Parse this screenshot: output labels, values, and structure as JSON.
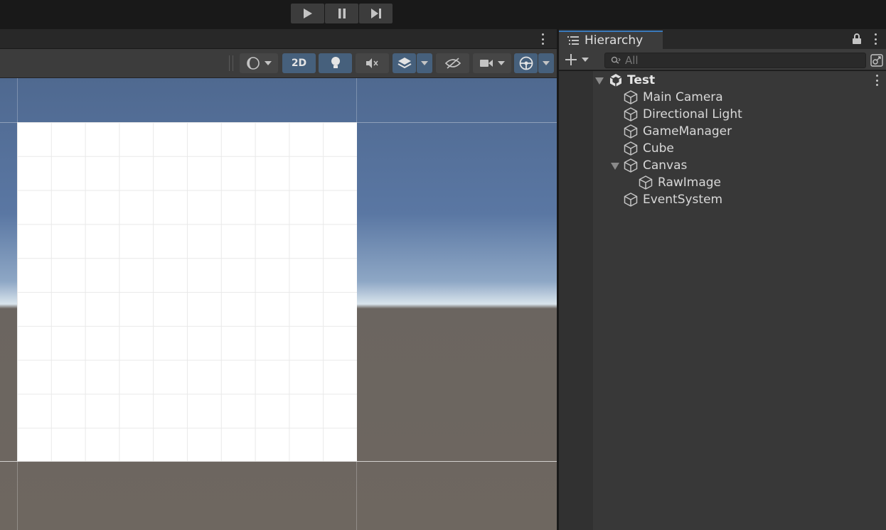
{
  "toolbar": {
    "play_icon": "play-icon",
    "pause_icon": "pause-icon",
    "step_icon": "step-icon"
  },
  "scene_toolbar": {
    "button_2d": "2D",
    "icons": [
      "shading-mode-icon",
      "lighting-icon",
      "audio-mute-icon",
      "effects-icon",
      "visibility-icon",
      "camera-icon",
      "gizmos-icon"
    ]
  },
  "hierarchy": {
    "tab_title": "Hierarchy",
    "search_placeholder": "All",
    "scene_name": "Test",
    "items": [
      {
        "label": "Main Camera"
      },
      {
        "label": "Directional Light"
      },
      {
        "label": "GameManager"
      },
      {
        "label": "Cube"
      },
      {
        "label": "Canvas"
      },
      {
        "label": "RawImage"
      },
      {
        "label": "EventSystem"
      }
    ]
  },
  "colors": {
    "accent": "#3a79bb",
    "active_button": "#46607c",
    "panel_bg": "#383838"
  }
}
